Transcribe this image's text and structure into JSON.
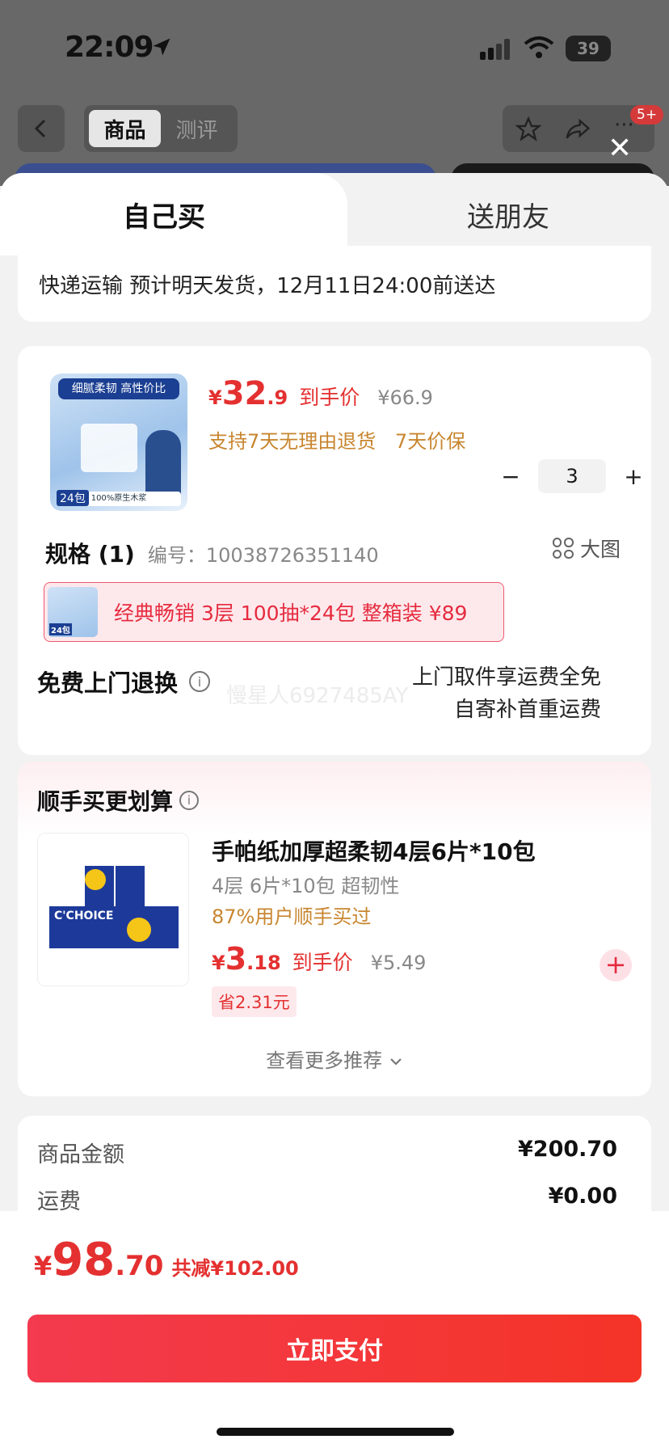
{
  "status": {
    "time": "22:09",
    "battery": "39"
  },
  "nav": {
    "tabs": [
      "商品",
      "测评"
    ],
    "badge": "5+"
  },
  "sheet": {
    "tabs": {
      "buy_self": "自己买",
      "gift": "送朋友"
    },
    "shipping": "快递运输 预计明天发货，12月11日24:00前送达",
    "product": {
      "currency": "¥",
      "price_int": "32",
      "price_dec": ".9",
      "price_tag": "到手价",
      "original_price": "¥66.9",
      "guarantees": [
        "支持7天无理由退货",
        "7天价保"
      ],
      "qty": {
        "minus": "−",
        "value": "3",
        "plus": "+"
      },
      "spec_title": "规格 (1)",
      "spec_code": "编号：10038726351140",
      "big_image": "大图",
      "sku_label": "经典畅销 3层 100抽*24包 整箱装  ¥89",
      "thumb_banner": "细腻柔韧 高性价比",
      "thumb_badge": "24包",
      "thumb_foot": "100%原生木浆",
      "return_title": "免费上门退换",
      "return_note_1": "上门取件享运费全免",
      "return_note_2": "自寄补首重运费",
      "watermark": "慢星人6927485AY"
    },
    "recommend": {
      "title": "顺手买更划算",
      "name": "手帕纸加厚超柔韧4层6片*10包",
      "sub": "4层 6片*10包 超韧性",
      "bought": "87%用户顺手买过",
      "currency": "¥",
      "price_int": "3",
      "price_dec": ".18",
      "price_tag": "到手价",
      "original_price": "¥5.49",
      "save": "省2.31元",
      "brand": "C'CHOICE",
      "more": "查看更多推荐"
    },
    "summary": {
      "goods_label": "商品金额",
      "goods_amount": "¥200.70",
      "freight_label": "运费",
      "freight_amount": "¥0.00"
    }
  },
  "footer": {
    "currency": "¥",
    "total_int": "98",
    "total_dec": ".70",
    "discount": "共减¥102.00",
    "pay_label": "立即支付"
  },
  "colors": {
    "accent": "#e43030",
    "gold": "#c8862f",
    "pay_start": "#f33a4e",
    "pay_end": "#f43427"
  }
}
